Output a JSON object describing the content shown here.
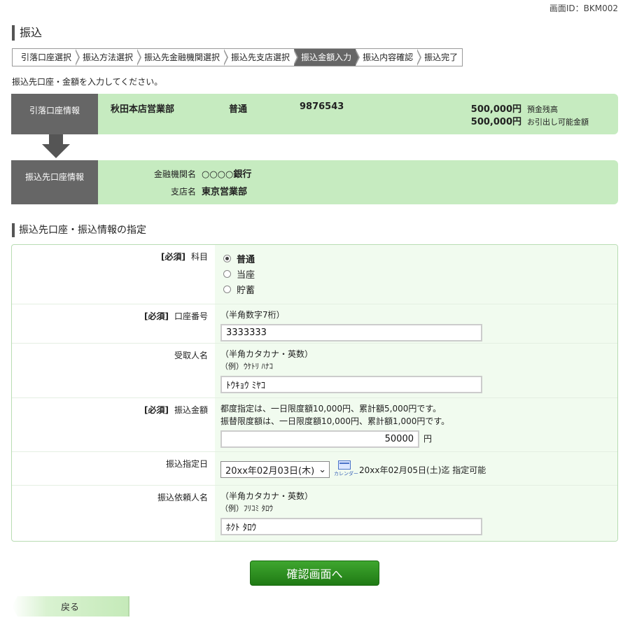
{
  "screen_id": "画面ID：BKM002",
  "page_title": "振込",
  "steps": [
    {
      "label": "引落口座選択"
    },
    {
      "label": "振込方法選択"
    },
    {
      "label": "振込先金融機関選択"
    },
    {
      "label": "振込先支店選択"
    },
    {
      "label": "振込金額入力",
      "active": true
    },
    {
      "label": "振込内容確認"
    },
    {
      "label": "振込完了"
    }
  ],
  "instruction": "振込先口座・金額を入力してください。",
  "from_account": {
    "label": "引落口座情報",
    "branch": "秋田本店営業部",
    "type": "普通",
    "number": "9876543",
    "balance_amount": "500,000円",
    "balance_label": "預金残高",
    "available_amount": "500,000円",
    "available_label": "お引出し可能金額"
  },
  "to_account": {
    "label": "振込先口座情報",
    "bank_label": "金融機関名",
    "bank_value": "○○○○銀行",
    "branch_label": "支店名",
    "branch_value": "東京営業部"
  },
  "section_title": "振込先口座・振込情報の指定",
  "form": {
    "required_tag": "[必須]",
    "subject": {
      "label": "科目",
      "options": [
        "普通",
        "当座",
        "貯蓄"
      ],
      "selected": "普通"
    },
    "account_number": {
      "label": "口座番号",
      "note": "（半角数字7桁）",
      "value": "3333333"
    },
    "recipient": {
      "label": "受取人名",
      "note": "（半角カタカナ・英数）",
      "example": "（例）ｳｹﾄﾘ ﾊﾅｺ",
      "value": "ﾄｳｷｮｳ ﾐﾔｺ"
    },
    "amount": {
      "label": "振込金額",
      "note1": "都度指定は、一日限度額10,000円、累計額5,000円です。",
      "note2": "振替限度額は、一日限度額10,000円、累計額1,000円です。",
      "value": "50000",
      "unit": "円"
    },
    "date": {
      "label": "振込指定日",
      "selected": "20xx年02月03日(木)",
      "calendar_label": "カレンダー",
      "note": "20xx年02月05日(土)迄 指定可能"
    },
    "requester": {
      "label": "振込依頼人名",
      "note": "（半角カタカナ・英数）",
      "example": "（例）ﾌﾘｺﾐ ﾀﾛｳ",
      "value": "ﾎｸﾄ ﾀﾛｳ"
    }
  },
  "buttons": {
    "confirm": "確認画面へ",
    "back": "戻る"
  }
}
